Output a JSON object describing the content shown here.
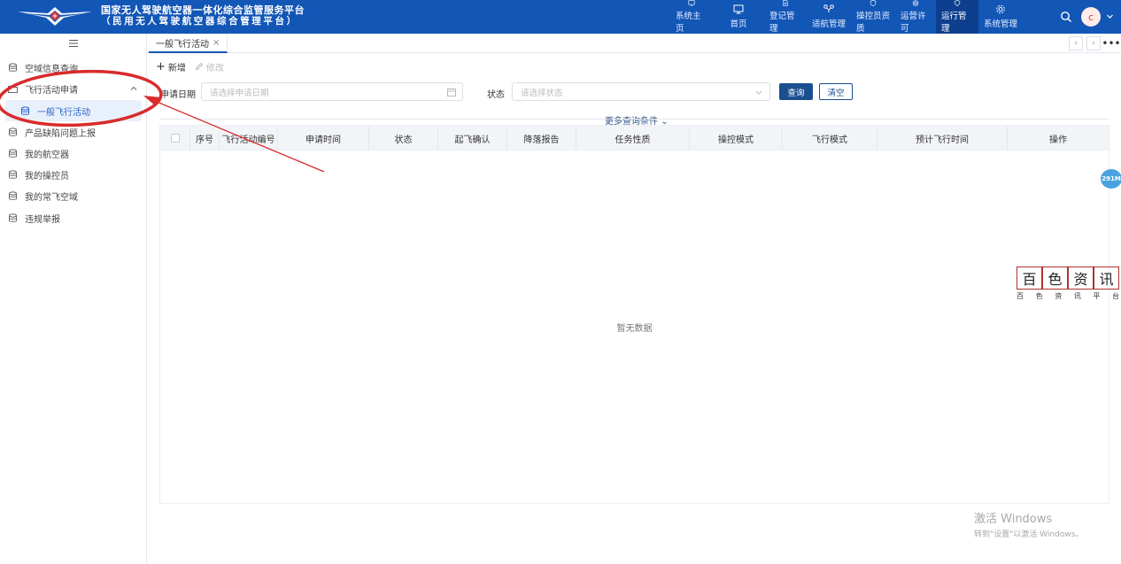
{
  "header": {
    "title_line1": "国家无人驾驶航空器一体化综合监管服务平台",
    "title_line2": "（民用无人驾驶航空器综合管理平台）",
    "brand_color": "#1256b6",
    "nav": [
      {
        "label": "系统主页",
        "icon": "monitor-icon"
      },
      {
        "label": "首页",
        "icon": "desktop-icon"
      },
      {
        "label": "登记管理",
        "icon": "document-icon"
      },
      {
        "label": "适航管理",
        "icon": "drone-icon"
      },
      {
        "label": "操控员资质",
        "icon": "shield-icon"
      },
      {
        "label": "运营许可",
        "icon": "badge-icon"
      },
      {
        "label": "运行管理",
        "icon": "gear-shield-icon"
      },
      {
        "label": "系统管理",
        "icon": "cog-icon"
      }
    ],
    "active_nav": "运行管理",
    "avatar_letter": "c"
  },
  "sidebar": {
    "items": [
      {
        "label": "空域信息查询",
        "icon": "database-icon"
      },
      {
        "label": "飞行活动申请",
        "icon": "folder-icon"
      },
      {
        "label": "一般飞行活动",
        "icon": "database-icon"
      },
      {
        "label": "产品缺陷问题上报",
        "icon": "database-icon"
      },
      {
        "label": "我的航空器",
        "icon": "database-icon"
      },
      {
        "label": "我的操控员",
        "icon": "database-icon"
      },
      {
        "label": "我的常飞空域",
        "icon": "database-icon"
      },
      {
        "label": "违规举报",
        "icon": "database-icon"
      }
    ]
  },
  "tabs": {
    "active": "一般飞行活动",
    "close": "×"
  },
  "toolbar": {
    "add_label": "新增",
    "edit_label": "修改"
  },
  "filters": {
    "date_label": "申请日期",
    "date_placeholder": "请选择申请日期",
    "status_label": "状态",
    "status_placeholder": "请选择状态",
    "query_label": "查询",
    "clear_label": "清空",
    "more_label": "更多查询条件"
  },
  "table": {
    "columns": [
      "序号",
      "飞行活动编号",
      "申请时间",
      "状态",
      "起飞确认",
      "降落报告",
      "任务性质",
      "操控模式",
      "飞行模式",
      "预计飞行时间",
      "操作"
    ],
    "empty_text": "暂无数据"
  },
  "misc": {
    "badge_text": "291M",
    "stamp_chars": [
      "百",
      "色",
      "资",
      "讯"
    ],
    "stamp_sub": [
      "百",
      "色",
      "资",
      "讯",
      "平",
      "台"
    ],
    "windows_activate": "激活 Windows",
    "windows_hint": "转到\"设置\"以激活 Windows。"
  }
}
